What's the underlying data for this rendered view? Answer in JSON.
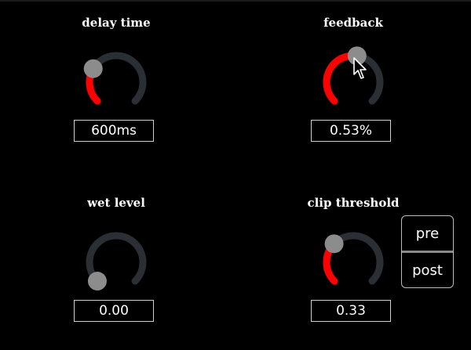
{
  "knobs": [
    {
      "id": "delay-time",
      "label": "delay time",
      "value_text": "600ms",
      "level": 0.28
    },
    {
      "id": "feedback",
      "label": "feedback",
      "value_text": "0.53%",
      "level": 0.53
    },
    {
      "id": "wet-level",
      "label": "wet level",
      "value_text": "0.00",
      "level": 0.0
    },
    {
      "id": "clip-threshold",
      "label": "clip threshold",
      "value_text": "0.33",
      "level": 0.33
    }
  ],
  "toggle": {
    "pre_label": "pre",
    "post_label": "post"
  },
  "colors": {
    "background": "#000000",
    "track": "#2a2f35",
    "fill": "#ff0000",
    "thumb": "#8c8c8c",
    "border": "#cfcfcf"
  }
}
